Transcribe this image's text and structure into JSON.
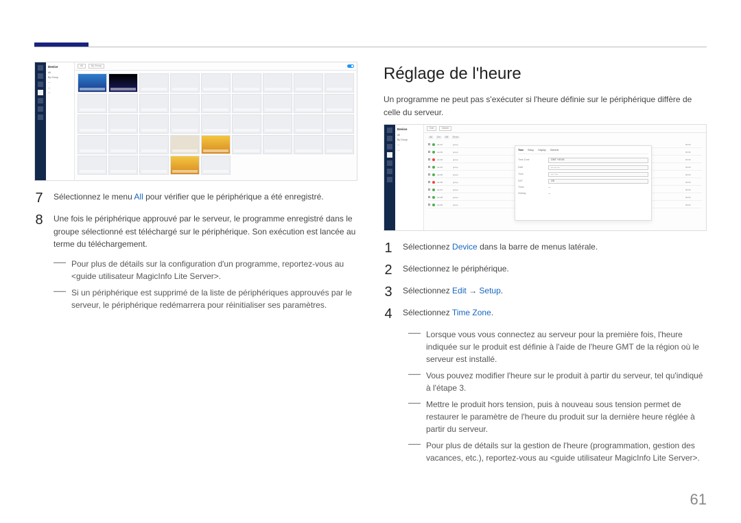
{
  "page_number": "61",
  "left": {
    "screenshot": {
      "section_label": "Device",
      "tab_all": "All",
      "tab_byGroup": "By Group"
    },
    "steps": [
      {
        "num": "7",
        "parts": [
          {
            "t": "Sélectionnez le menu "
          },
          {
            "t": "All",
            "link": true
          },
          {
            "t": " pour vérifier que le périphérique a été enregistré."
          }
        ]
      },
      {
        "num": "8",
        "parts": [
          {
            "t": "Une fois le périphérique approuvé par le serveur, le programme enregistré dans le groupe sélectionné est téléchargé sur le périphérique. Son exécution est lancée au terme du téléchargement."
          }
        ]
      }
    ],
    "notes": [
      "Pour plus de détails sur la configuration d'un programme, reportez-vous au <guide utilisateur MagicInfo Lite Server>.",
      "Si un périphérique est supprimé de la liste de périphériques approuvés par le serveur, le périphérique redémarrera pour réinitialiser ses paramètres."
    ]
  },
  "right": {
    "title": "Réglage de l'heure",
    "intro": "Un programme ne peut pas s'exécuter si l'heure définie sur le périphérique diffère de celle du serveur.",
    "screenshot": {
      "section_label": "Device",
      "panel_tab_time": "Time",
      "panel_tab_setup": "Setup",
      "panel_label_timezone": "Time Zone"
    },
    "steps": [
      {
        "num": "1",
        "parts": [
          {
            "t": "Sélectionnez "
          },
          {
            "t": "Device",
            "link": true
          },
          {
            "t": " dans la barre de menus latérale."
          }
        ]
      },
      {
        "num": "2",
        "parts": [
          {
            "t": "Sélectionnez le périphérique."
          }
        ]
      },
      {
        "num": "3",
        "parts": [
          {
            "t": "Sélectionnez "
          },
          {
            "t": "Edit",
            "link": true
          },
          {
            "t": " → "
          },
          {
            "t": "Setup",
            "link": true
          },
          {
            "t": "."
          }
        ]
      },
      {
        "num": "4",
        "parts": [
          {
            "t": "Sélectionnez "
          },
          {
            "t": "Time Zone",
            "link": true
          },
          {
            "t": "."
          }
        ]
      }
    ],
    "notes": [
      "Lorsque vous vous connectez au serveur pour la première fois, l'heure indiquée sur le produit est définie à l'aide de l'heure GMT de la région où le serveur est installé.",
      "Vous pouvez modifier l'heure sur le produit à partir du serveur, tel qu'indiqué à l'étape 3.",
      "Mettre le produit hors tension, puis à nouveau sous tension permet de restaurer le paramètre de l'heure du produit sur la dernière heure réglée à partir du serveur.",
      "Pour plus de détails sur la gestion de l'heure (programmation, gestion des vacances, etc.), reportez-vous au <guide utilisateur MagicInfo Lite Server>."
    ]
  }
}
